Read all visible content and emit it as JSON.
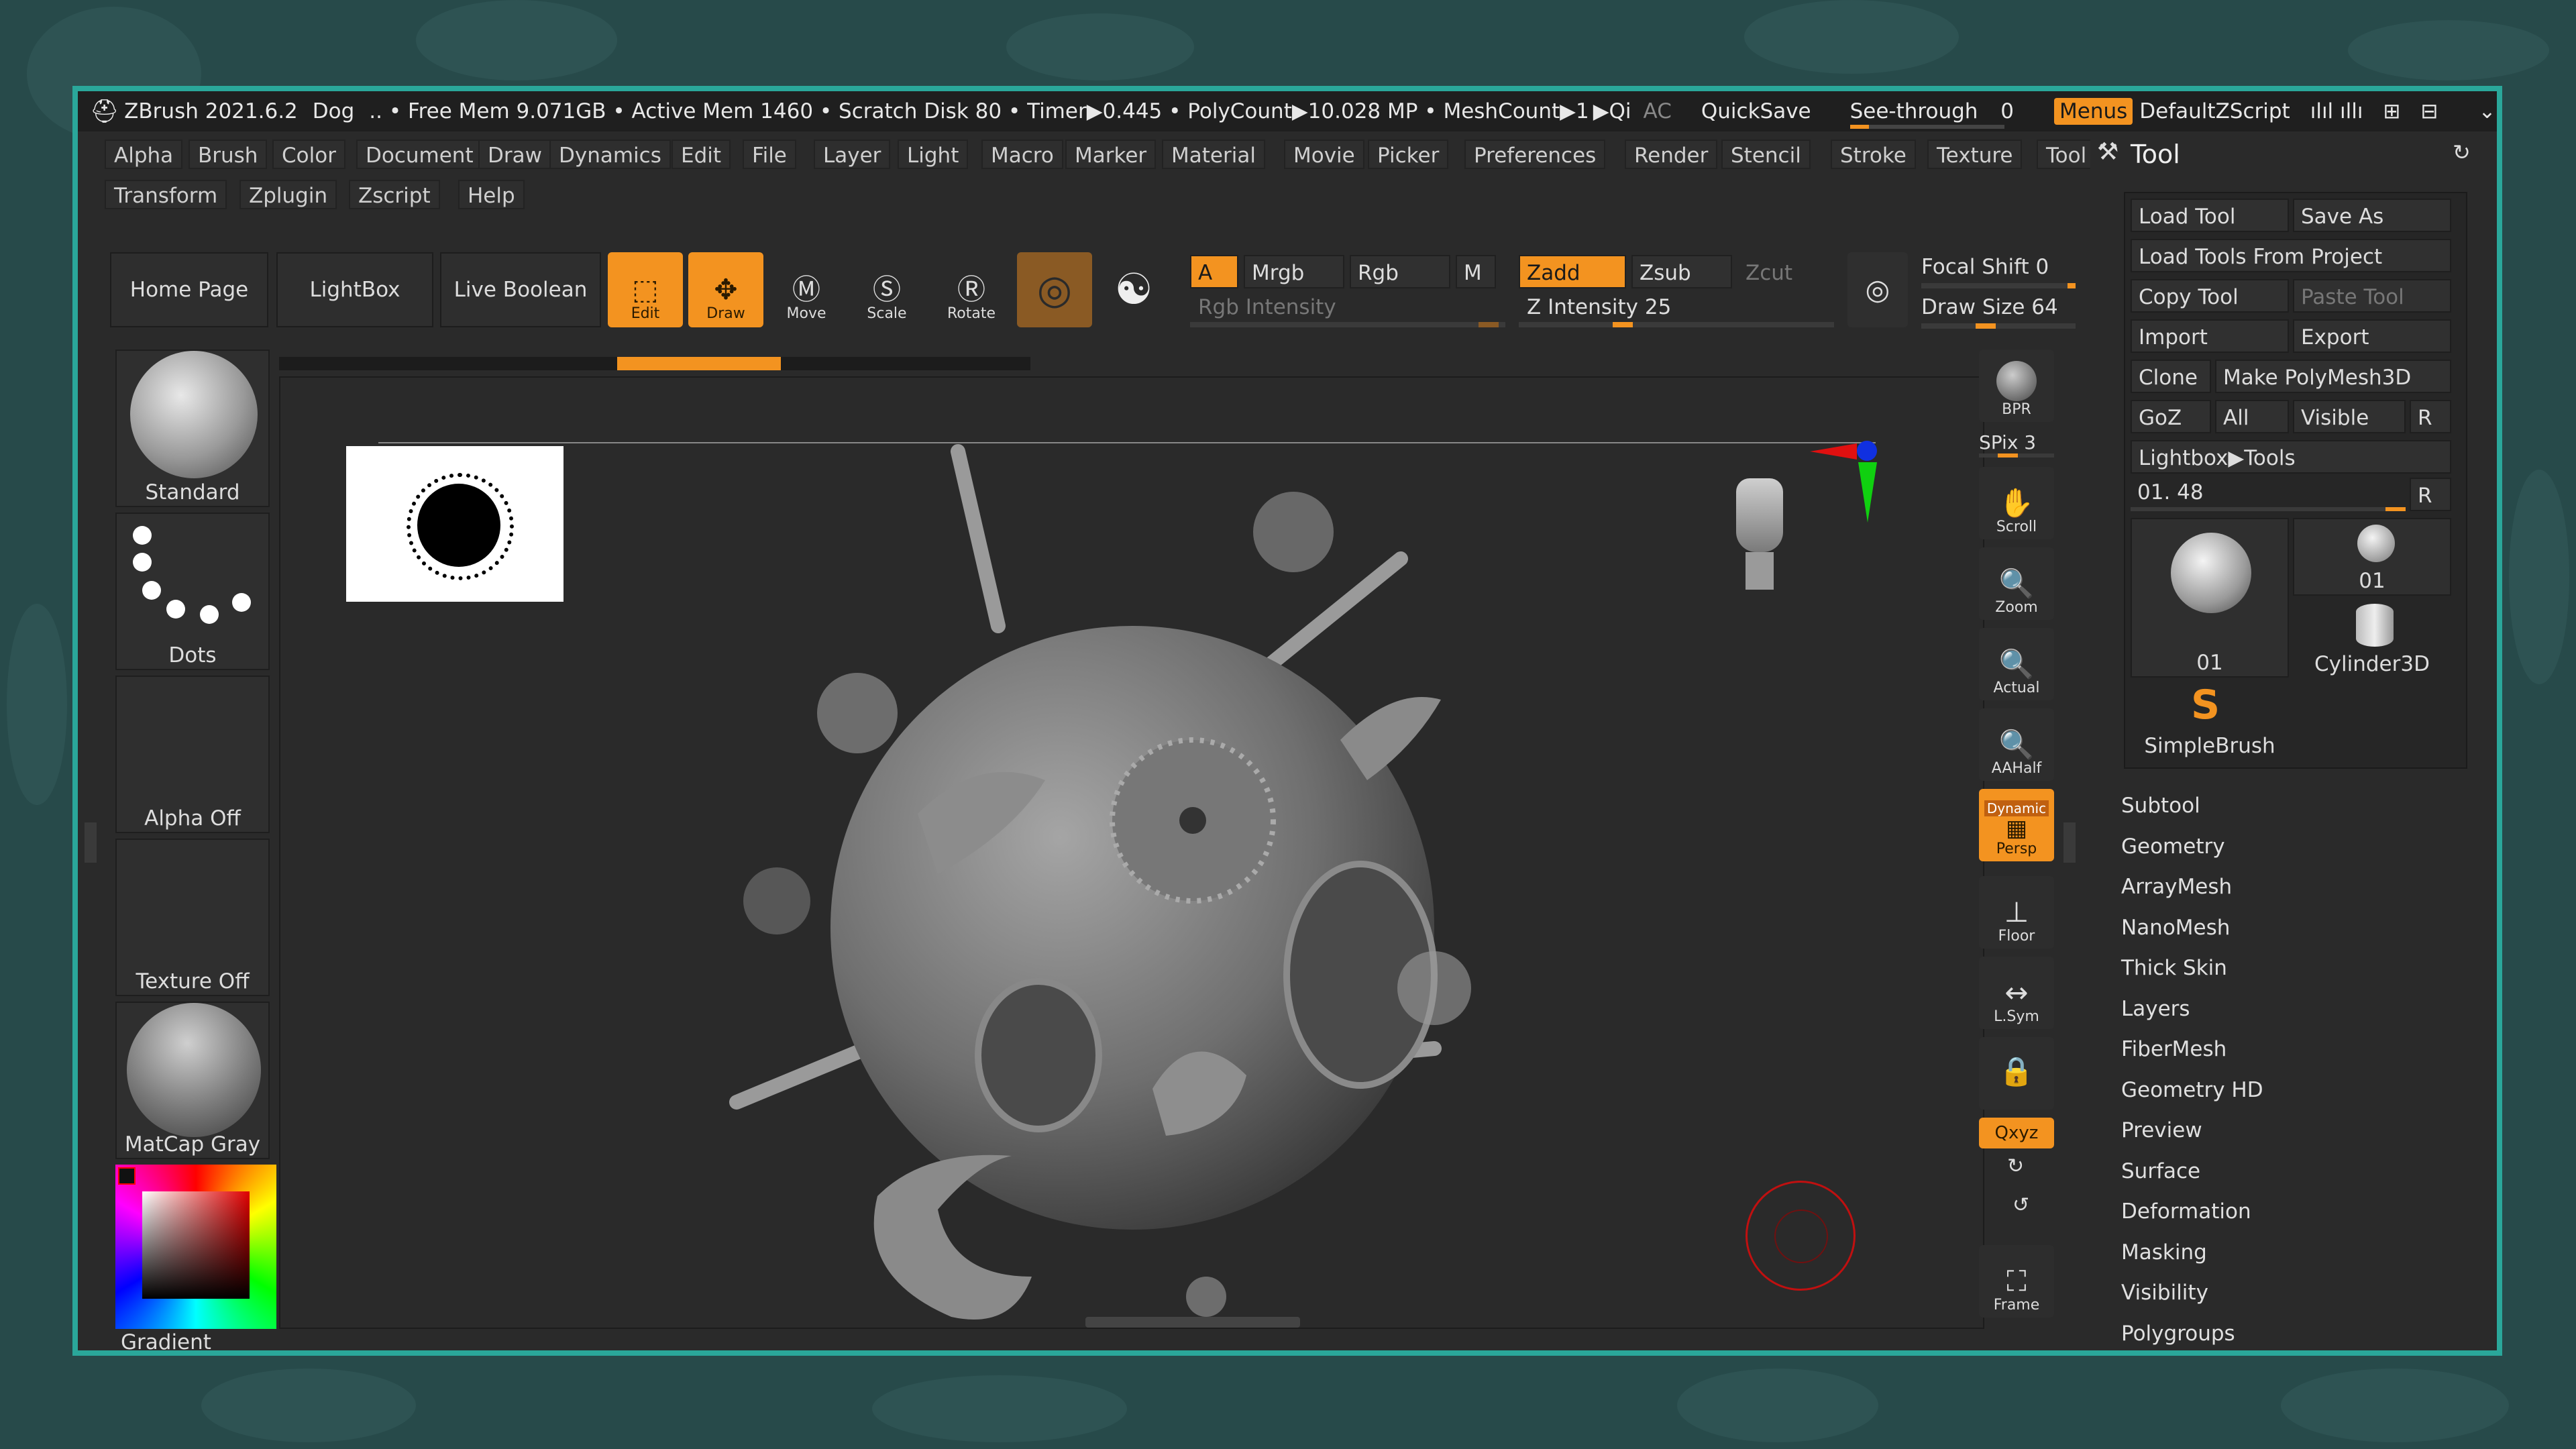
{
  "titlebar": {
    "app": "ZBrush 2021.6.2",
    "doc": "Dog",
    "stats": ".. • Free Mem 9.071GB • Active Mem 1460 • Scratch Disk 80 • Timer▶0.445 • PolyCount▶10.028 MP • MeshCount▶1",
    "qi": "▶Qi",
    "ac": "AC",
    "quicksave": "QuickSave",
    "seethrough": "See-through",
    "seethrough_value": "0",
    "menus": "Menus",
    "script": "DefaultZScript"
  },
  "menus": [
    "Alpha",
    "Brush",
    "Color",
    "Document",
    "Draw",
    "Dynamics",
    "Edit",
    "File",
    "Layer",
    "Light",
    "Macro",
    "Marker",
    "Material",
    "Movie",
    "Picker",
    "Preferences",
    "Render",
    "Stencil",
    "Stroke",
    "Texture",
    "Tool"
  ],
  "menus_row2": [
    "Transform",
    "Zplugin",
    "Zscript",
    "Help"
  ],
  "shelf": {
    "home": "Home Page",
    "lightbox": "LightBox",
    "liveboolean": "Live Boolean",
    "edit": "Edit",
    "draw": "Draw",
    "move": "Move",
    "scale": "Scale",
    "rotate": "Rotate",
    "a": "A",
    "mrgb": "Mrgb",
    "rgb": "Rgb",
    "m": "M",
    "rgb_intensity": "Rgb Intensity",
    "zadd": "Zadd",
    "zsub": "Zsub",
    "zcut": "Zcut",
    "z_intensity": "Z Intensity 25",
    "focal_shift": "Focal Shift 0",
    "draw_size": "Draw Size 64",
    "z_intensity_level": 0.25,
    "draw_size_level": 0.35
  },
  "left": {
    "brush": "Standard",
    "stroke": "Dots",
    "alpha": "Alpha Off",
    "texture": "Texture Off",
    "material": "MatCap Gray",
    "gradient": "Gradient"
  },
  "righttools": {
    "bpr": "BPR",
    "spix": "SPix 3",
    "scroll": "Scroll",
    "zoom": "Zoom",
    "actual": "Actual",
    "aahalf": "AAHalf",
    "dynamic": "Dynamic",
    "persp": "Persp",
    "floor": "Floor",
    "lsym": "L.Sym",
    "xyz": "Qxyz",
    "frame": "Frame"
  },
  "toolpanel": {
    "title": "Tool",
    "load_tool": "Load Tool",
    "save_as": "Save As",
    "load_from_project": "Load Tools From Project",
    "copy_tool": "Copy Tool",
    "paste_tool": "Paste Tool",
    "import": "Import",
    "export": "Export",
    "clone": "Clone",
    "make_polymesh": "Make PolyMesh3D",
    "goz": "GoZ",
    "all": "All",
    "visible": "Visible",
    "r": "R",
    "lightbox_tools": "Lightbox▶Tools",
    "tool_slider": "01. 48",
    "thumb1": "01",
    "thumb2": "01",
    "thumb3": "Cylinder3D",
    "thumb4": "SimpleBrush",
    "subpalettes": [
      "Subtool",
      "Geometry",
      "ArrayMesh",
      "NanoMesh",
      "Thick Skin",
      "Layers",
      "FiberMesh",
      "Geometry HD",
      "Preview",
      "Surface",
      "Deformation",
      "Masking",
      "Visibility",
      "Polygroups"
    ]
  },
  "colors": {
    "accent": "#f39320",
    "frame": "#2aa79a",
    "bg": "#274a4a"
  }
}
